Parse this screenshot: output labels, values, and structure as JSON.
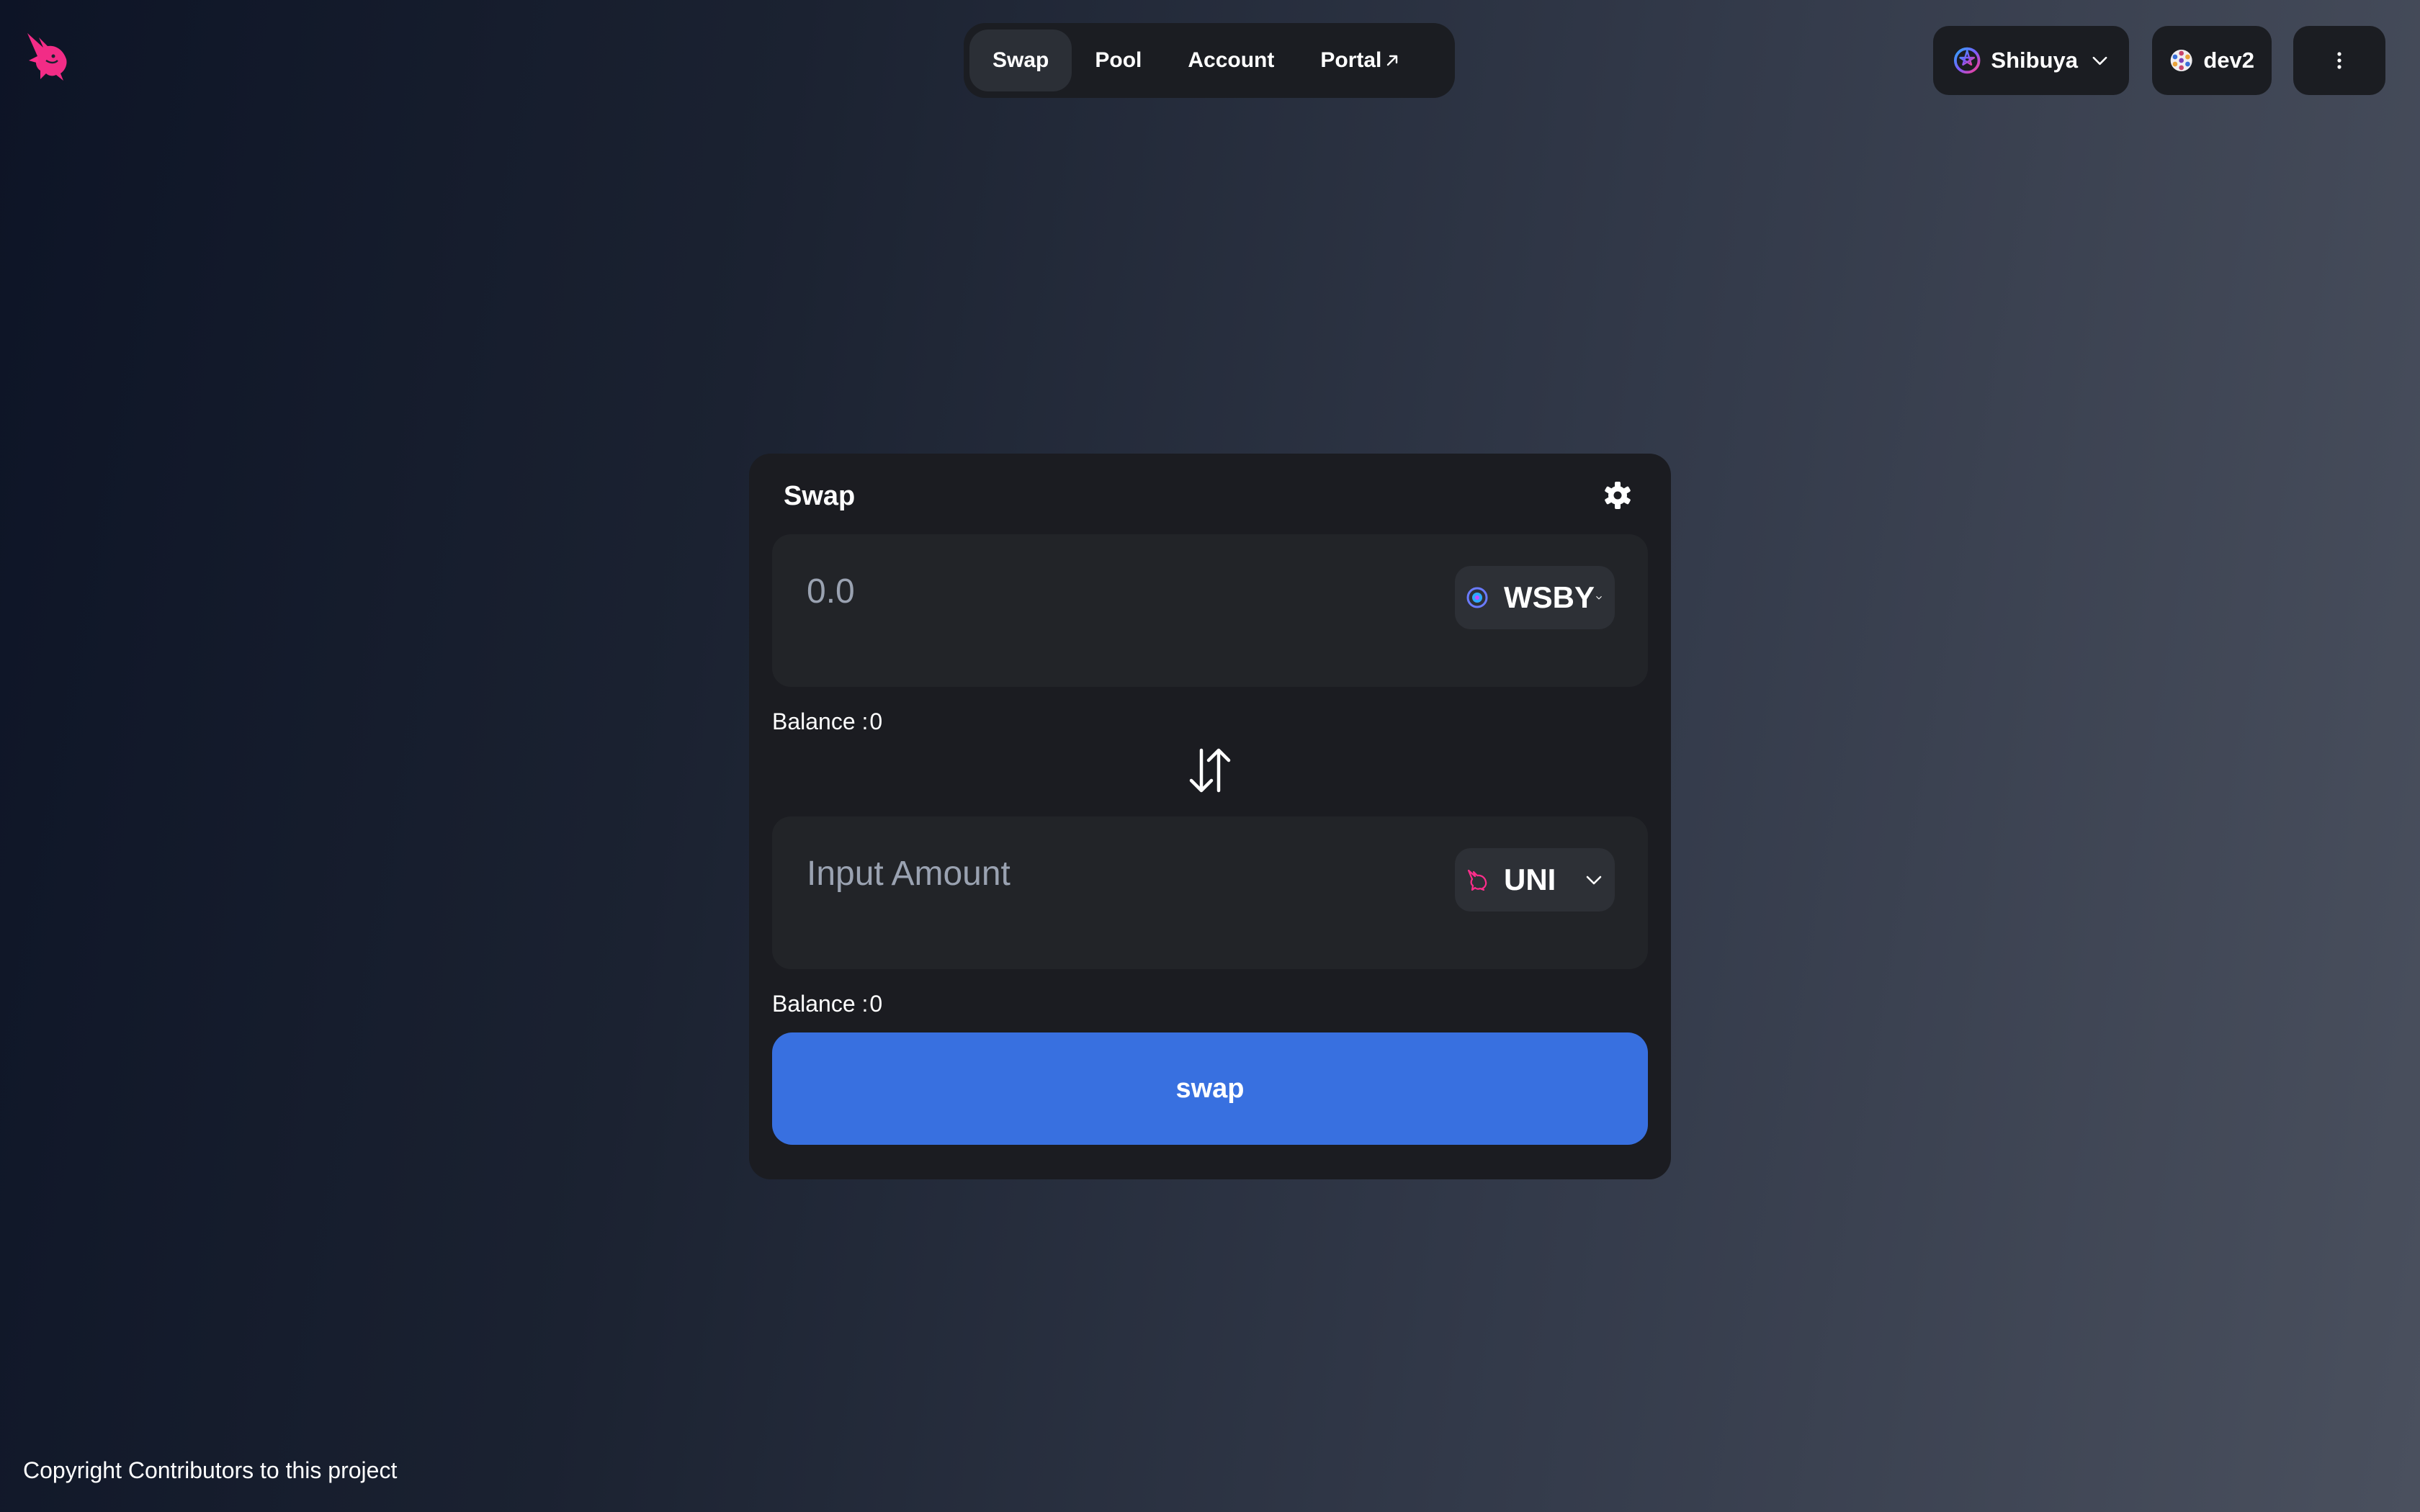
{
  "header": {
    "logo_icon": "unicorn-logo-icon",
    "nav": [
      {
        "label": "Swap",
        "active": true
      },
      {
        "label": "Pool",
        "active": false
      },
      {
        "label": "Account",
        "active": false
      },
      {
        "label": "Portal",
        "active": false,
        "external": true
      }
    ],
    "network": {
      "label": "Shibuya",
      "icon": "astar-network-icon"
    },
    "account": {
      "label": "dev2",
      "icon": "account-avatar-icon"
    },
    "more_icon": "vertical-dots-icon"
  },
  "swap_card": {
    "title": "Swap",
    "settings_icon": "gear-icon",
    "from": {
      "placeholder": "0.0",
      "value": "",
      "token": "WSBY",
      "token_icon": "wsby-token-icon",
      "balance_label": "Balance :",
      "balance_value": "0"
    },
    "switch_icon": "swap-arrows-icon",
    "to": {
      "placeholder": "Input Amount",
      "value": "",
      "token": "UNI",
      "token_icon": "uni-token-icon",
      "balance_label": "Balance :",
      "balance_value": "0"
    },
    "button_label": "swap"
  },
  "footer": {
    "text": "Copyright Contributors to this project"
  },
  "colors": {
    "accent_blue": "#3870e0",
    "brand_pink": "#ff007a",
    "card_bg": "#1b1c21",
    "input_bg": "#222428"
  }
}
